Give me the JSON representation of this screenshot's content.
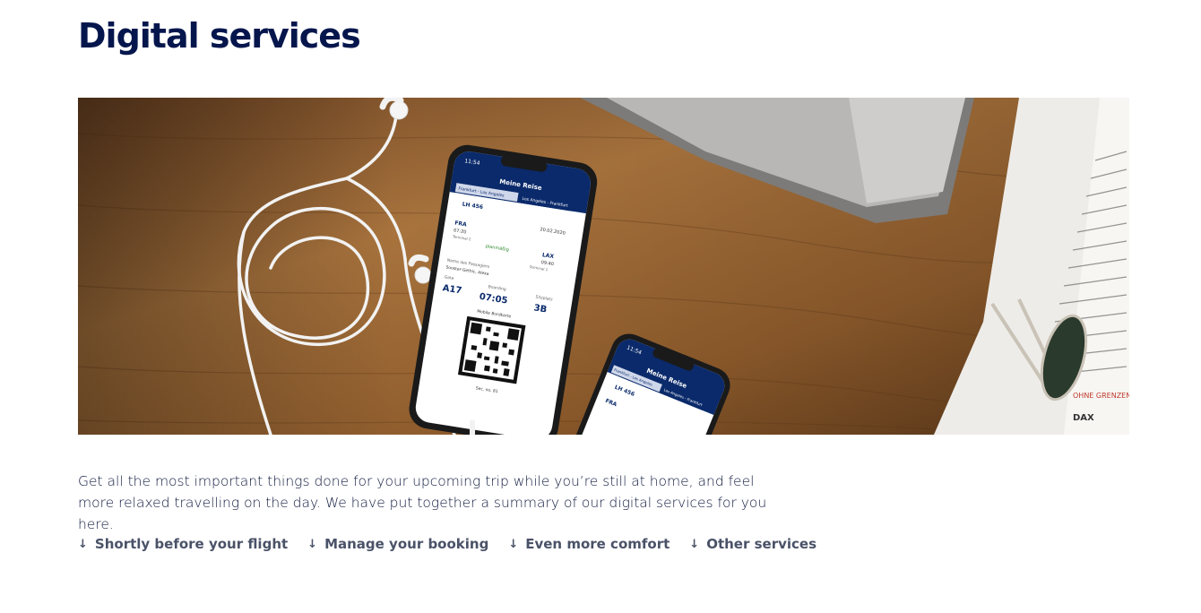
{
  "page": {
    "title": "Digital services",
    "intro": "Get all the most important things done for your upcoming trip while you’re still at home, and feel more relaxed travelling on the day. We have put together a summary of our digital services for you here."
  },
  "hero": {
    "image_description_icon": "phones-with-boarding-pass-image",
    "phone1": {
      "status_time": "11:54",
      "header": "Meine Reise",
      "tab_active": "Frankfurt - Los Angeles",
      "tab_inactive": "Los Angeles - Frankfurt",
      "flight": "LH 456",
      "date": "20.02.2020",
      "from_code": "FRA",
      "from_time": "07:20",
      "from_terminal": "Terminal 2",
      "to_code": "LAX",
      "to_time": "09:40",
      "to_terminal": "Terminal 1",
      "status": "planmäßig",
      "passenger_label": "Name des Passagiers",
      "passenger_name": "Sooster-Gethic, Alexa",
      "gate_label": "Gate",
      "gate": "A17",
      "boarding_label": "Boarding",
      "boarding": "07:05",
      "seat_label": "Sitzplatz",
      "seat": "3B",
      "qr_label": "Mobile Bordkarte",
      "seq": "Sec. no. 81"
    },
    "phone2": {
      "status_time": "11:54",
      "header": "Meine Reise",
      "tab_active": "Frankfurt - Los Angeles",
      "tab_inactive": "Los Angeles - Frankfurt",
      "flight": "LH 456",
      "from_code": "FRA"
    },
    "newspaper": {
      "headline": "DAX",
      "tag": "OHNE GRENZEN"
    }
  },
  "anchors": [
    {
      "label": "Shortly before your flight",
      "icon": "arrow-down-icon"
    },
    {
      "label": "Manage your booking",
      "icon": "arrow-down-icon"
    },
    {
      "label": "Even more comfort",
      "icon": "arrow-down-icon"
    },
    {
      "label": "Other services",
      "icon": "arrow-down-icon"
    }
  ],
  "colors": {
    "brand_navy": "#05164d",
    "anchor_gray": "#4a5268",
    "wood": "#8a5a2e"
  }
}
